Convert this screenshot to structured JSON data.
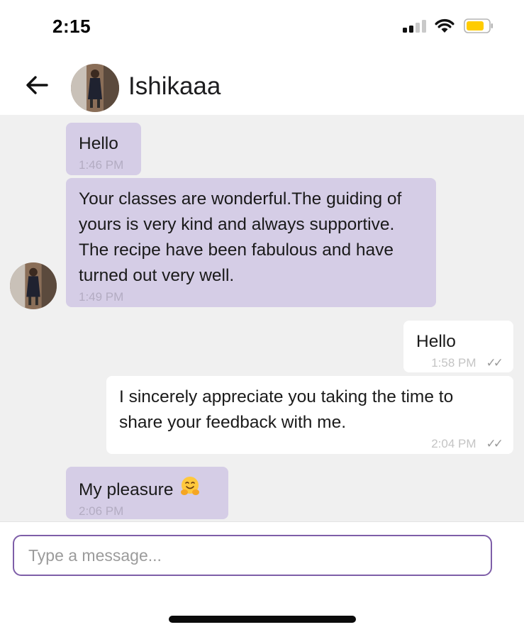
{
  "status_bar": {
    "time": "2:15",
    "battery_color": "#ffcc00"
  },
  "header": {
    "contact_name": "Ishikaaa",
    "back_icon": "arrow-left-icon"
  },
  "messages": [
    {
      "direction": "incoming",
      "text": "Hello",
      "time": "1:46 PM"
    },
    {
      "direction": "incoming",
      "text": "Your classes are wonderful.The guiding of yours is very kind and always supportive. The recipe have been fabulous and have turned out very well.",
      "time": "1:49 PM"
    },
    {
      "direction": "outgoing",
      "text": "Hello",
      "time": "1:58 PM",
      "status_icon": "double-check-icon"
    },
    {
      "direction": "outgoing",
      "text": "I sincerely appreciate you taking the time to share your feedback with me.",
      "time": "2:04 PM",
      "status_icon": "double-check-icon"
    },
    {
      "direction": "incoming",
      "text": "My pleasure",
      "emoji": "hugging-face-icon",
      "time": "2:06 PM"
    }
  ],
  "composer": {
    "placeholder": "Type a message..."
  },
  "colors": {
    "incoming_bubble": "#d5cde6",
    "outgoing_bubble": "#ffffff",
    "chat_background": "#f0f0f0",
    "input_border": "#7e5ea8"
  }
}
